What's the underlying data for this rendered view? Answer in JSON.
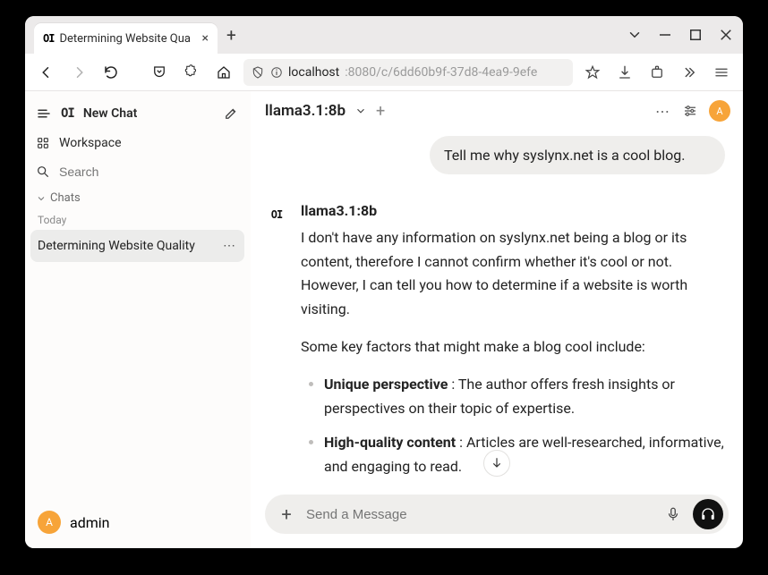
{
  "browser": {
    "tab_title": "Determining Website Qua",
    "url_host": "localhost",
    "url_rest": ":8080/c/6dd60b9f-37d8-4ea9-9efe"
  },
  "sidebar": {
    "new_chat_label": "New Chat",
    "workspace_label": "Workspace",
    "search_placeholder": "Search",
    "section_chats": "Chats",
    "day_label": "Today",
    "active_chat_title": "Determining Website Quality",
    "user_name": "admin",
    "user_initial": "A"
  },
  "header": {
    "model_name": "llama3.1:8b",
    "avatar_initial": "A"
  },
  "conversation": {
    "user_message": "Tell me why syslynx.net is a cool blog.",
    "assistant_name": "llama3.1:8b",
    "assistant_paragraph1": "I don't have any information on syslynx.net being a blog or its content, therefore I cannot confirm whether it's cool or not. However, I can tell you how to determine if a website is worth visiting.",
    "assistant_paragraph2": "Some key factors that might make a blog cool include:",
    "bullets": [
      {
        "term": "Unique perspective",
        "rest": " : The author offers fresh insights or perspectives on their topic of expertise."
      },
      {
        "term": "High-quality content",
        "rest": " : Articles are well-researched, informative, and engaging to read."
      }
    ]
  },
  "composer": {
    "placeholder": "Send a Message"
  }
}
